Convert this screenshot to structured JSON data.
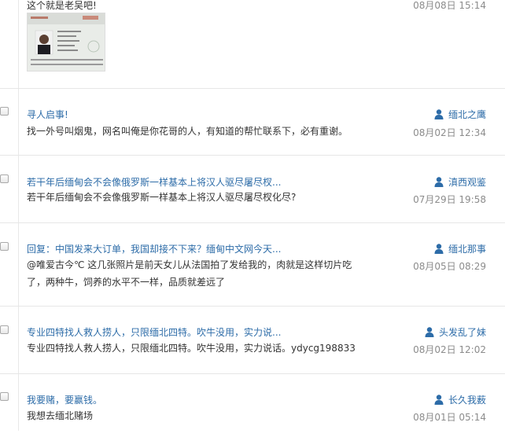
{
  "messages": [
    {
      "text": "这个就是老吴吧!",
      "date": "08月08日 15:14"
    },
    {
      "title": "寻人启事!",
      "author": "缅北之鹰",
      "text": "找一外号叫烟鬼，网名叫俺是你花哥的人，有知道的帮忙联系下，必有重谢。",
      "date": "08月02日 12:34"
    },
    {
      "title": "若干年后缅甸会不会像俄罗斯一样基本上将汉人驱尽屠尽杈...",
      "author": "滇西观鉴",
      "text": "若干年后缅甸会不会像俄罗斯一样基本上将汉人驱尽屠尽杈化尽?",
      "date": "07月29日 19:58"
    },
    {
      "title": "回复：中国发来大订单，我国却接不下来？缅甸中文网今天...",
      "author": "缅北那事",
      "text_line1": "@唯爱古今℃ 这几张照片是前天女儿从法国拍了发给我的，肉就是这样切片吃",
      "text_line2": "了，两种牛，饲养的水平不一样，品质就差远了",
      "date": "08月05日 08:29"
    },
    {
      "title": "专业四特找人救人捞人，只限缅北四特。吹牛没用，实力说...",
      "author": "头发乱了妹",
      "text": "专业四特找人救人捞人，只限缅北四特。吹牛没用，实力说话。ydycg198833",
      "date": "08月02日 12:02"
    },
    {
      "title": "我要赌，要赢钱。",
      "author": "长久我薮",
      "text": "我想去缅北赌场",
      "date": "08月01日 05:14"
    }
  ],
  "colors": {
    "link": "#2d6ca8",
    "date": "#8c8c8c",
    "text": "#333333"
  },
  "icons": {
    "author": "user-icon",
    "checkbox": "checkbox"
  }
}
